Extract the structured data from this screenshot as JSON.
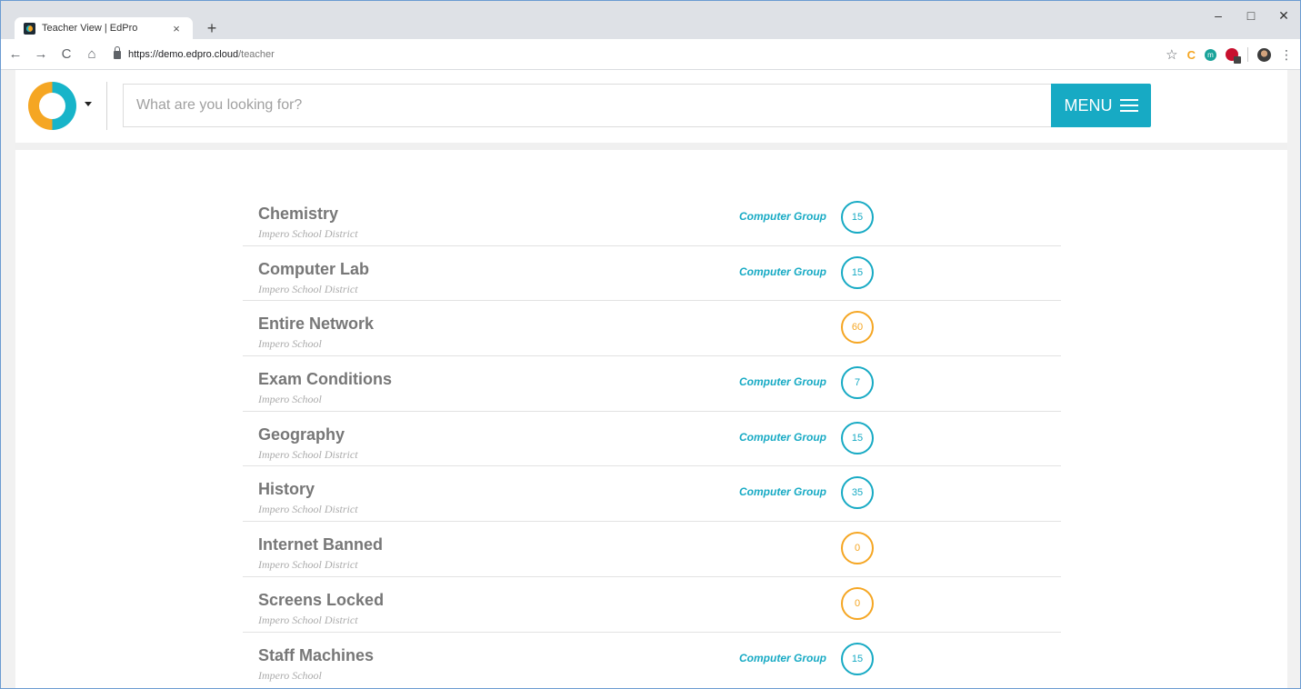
{
  "browser": {
    "tab_title": "Teacher View | EdPro",
    "tab_close": "×",
    "new_tab": "+",
    "url_host": "https://demo.edpro.cloud",
    "url_path": "/teacher",
    "win_minimize": "–",
    "win_maximize": "□",
    "win_close": "✕",
    "ext_c_label": "C",
    "ext_m_label": "m"
  },
  "header": {
    "search_placeholder": "What are you looking for?",
    "menu_label": "MENU"
  },
  "colors": {
    "accent_teal": "#17aac4",
    "accent_orange": "#f5a623"
  },
  "groups": [
    {
      "name": "Chemistry",
      "org": "Impero School District",
      "tag": "Computer Group",
      "count": "15",
      "count_color": "teal"
    },
    {
      "name": "Computer Lab",
      "org": "Impero School District",
      "tag": "Computer Group",
      "count": "15",
      "count_color": "teal"
    },
    {
      "name": "Entire Network",
      "org": "Impero School",
      "tag": "",
      "count": "60",
      "count_color": "orange"
    },
    {
      "name": "Exam Conditions",
      "org": "Impero School",
      "tag": "Computer Group",
      "count": "7",
      "count_color": "teal"
    },
    {
      "name": "Geography",
      "org": "Impero School District",
      "tag": "Computer Group",
      "count": "15",
      "count_color": "teal"
    },
    {
      "name": "History",
      "org": "Impero School District",
      "tag": "Computer Group",
      "count": "35",
      "count_color": "teal"
    },
    {
      "name": "Internet Banned",
      "org": "Impero School District",
      "tag": "",
      "count": "0",
      "count_color": "orange"
    },
    {
      "name": "Screens Locked",
      "org": "Impero School District",
      "tag": "",
      "count": "0",
      "count_color": "orange"
    },
    {
      "name": "Staff Machines",
      "org": "Impero School",
      "tag": "Computer Group",
      "count": "15",
      "count_color": "teal"
    }
  ]
}
